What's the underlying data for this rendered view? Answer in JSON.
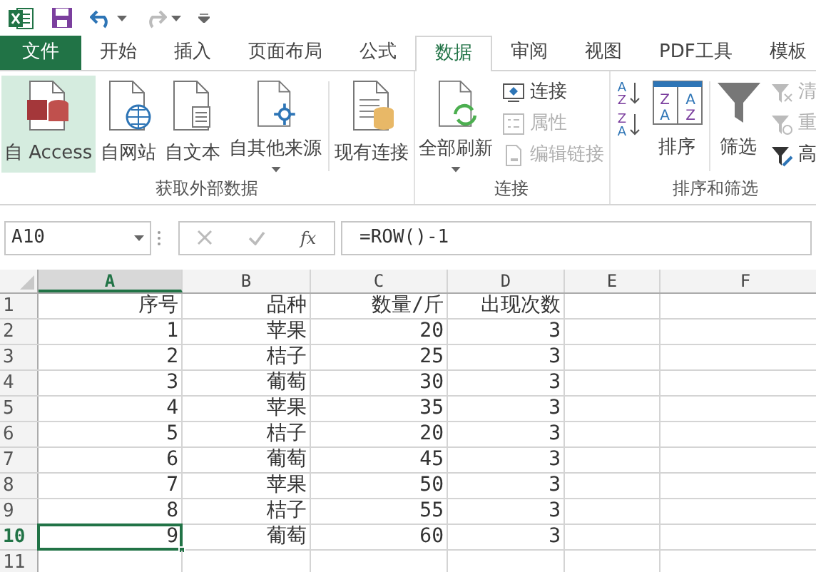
{
  "tabs": [
    {
      "label": "文件",
      "kind": "file",
      "selected": false
    },
    {
      "label": "开始",
      "kind": "tab",
      "selected": false
    },
    {
      "label": "插入",
      "kind": "tab",
      "selected": false
    },
    {
      "label": "页面布局",
      "kind": "tab",
      "selected": false
    },
    {
      "label": "公式",
      "kind": "tab",
      "selected": false
    },
    {
      "label": "数据",
      "kind": "tab",
      "selected": true
    },
    {
      "label": "审阅",
      "kind": "tab",
      "selected": false
    },
    {
      "label": "视图",
      "kind": "tab",
      "selected": false
    },
    {
      "label": "PDF工具",
      "kind": "tab",
      "selected": false
    },
    {
      "label": "模板",
      "kind": "tab",
      "selected": false
    }
  ],
  "ribbon": {
    "groups": [
      {
        "label": "获取外部数据",
        "items": [
          {
            "kind": "large",
            "label": "自 Access",
            "selected": true
          },
          {
            "kind": "large",
            "label": "自网站",
            "selected": false
          },
          {
            "kind": "large",
            "label": "自文本",
            "selected": false
          },
          {
            "kind": "large",
            "label": "自其他来源",
            "selected": false,
            "dropdown": true
          },
          {
            "kind": "separator"
          },
          {
            "kind": "large",
            "label": "现有连接",
            "selected": false
          }
        ]
      },
      {
        "label": "连接",
        "items": [
          {
            "kind": "large",
            "label": "全部刷新",
            "selected": false,
            "dropdown": true
          },
          {
            "kind": "stack",
            "buttons": [
              {
                "label": "连接",
                "disabled": false
              },
              {
                "label": "属性",
                "disabled": true
              },
              {
                "label": "编辑链接",
                "disabled": true
              }
            ]
          }
        ]
      },
      {
        "label": "排序和筛选",
        "items": [
          {
            "kind": "stack",
            "buttons": [
              {
                "letters": [
                  "A",
                  "Z"
                ]
              },
              {
                "letters": [
                  "Z",
                  "A"
                ]
              }
            ]
          },
          {
            "kind": "large",
            "label": "排序",
            "selected": false,
            "letters": [
              "Z",
              "A",
              "A",
              "Z"
            ]
          },
          {
            "kind": "separator"
          },
          {
            "kind": "large",
            "label": "筛选",
            "selected": false
          },
          {
            "kind": "stack",
            "buttons": [
              {
                "label": "清",
                "disabled": true
              },
              {
                "label": "重",
                "disabled": true
              },
              {
                "label": "高",
                "disabled": false
              }
            ]
          }
        ]
      }
    ]
  },
  "formula_bar": {
    "name_box": "A10",
    "fx": "fx",
    "formula": "=ROW()-1"
  },
  "sheet": {
    "columns": [
      {
        "label": "A",
        "selected": true
      },
      {
        "label": "B",
        "selected": false
      },
      {
        "label": "C",
        "selected": false
      },
      {
        "label": "D",
        "selected": false
      },
      {
        "label": "E",
        "selected": false
      },
      {
        "label": "F",
        "selected": false
      }
    ],
    "rows": [
      {
        "label": "1",
        "selected": false,
        "cells": [
          {
            "text": "序号",
            "selected": false
          },
          {
            "text": "品种",
            "selected": false
          },
          {
            "text": "数量/斤",
            "selected": false
          },
          {
            "text": "出现次数",
            "selected": false
          }
        ]
      },
      {
        "label": "2",
        "selected": false,
        "cells": [
          {
            "text": "1",
            "selected": false
          },
          {
            "text": "苹果",
            "selected": false
          },
          {
            "text": "20",
            "selected": false
          },
          {
            "text": "3",
            "selected": false
          }
        ]
      },
      {
        "label": "3",
        "selected": false,
        "cells": [
          {
            "text": "2",
            "selected": false
          },
          {
            "text": "桔子",
            "selected": false
          },
          {
            "text": "25",
            "selected": false
          },
          {
            "text": "3",
            "selected": false
          }
        ]
      },
      {
        "label": "4",
        "selected": false,
        "cells": [
          {
            "text": "3",
            "selected": false
          },
          {
            "text": "葡萄",
            "selected": false
          },
          {
            "text": "30",
            "selected": false
          },
          {
            "text": "3",
            "selected": false
          }
        ]
      },
      {
        "label": "5",
        "selected": false,
        "cells": [
          {
            "text": "4",
            "selected": false
          },
          {
            "text": "苹果",
            "selected": false
          },
          {
            "text": "35",
            "selected": false
          },
          {
            "text": "3",
            "selected": false
          }
        ]
      },
      {
        "label": "6",
        "selected": false,
        "cells": [
          {
            "text": "5",
            "selected": false
          },
          {
            "text": "桔子",
            "selected": false
          },
          {
            "text": "20",
            "selected": false
          },
          {
            "text": "3",
            "selected": false
          }
        ]
      },
      {
        "label": "7",
        "selected": false,
        "cells": [
          {
            "text": "6",
            "selected": false
          },
          {
            "text": "葡萄",
            "selected": false
          },
          {
            "text": "45",
            "selected": false
          },
          {
            "text": "3",
            "selected": false
          }
        ]
      },
      {
        "label": "8",
        "selected": false,
        "cells": [
          {
            "text": "7",
            "selected": false
          },
          {
            "text": "苹果",
            "selected": false
          },
          {
            "text": "50",
            "selected": false
          },
          {
            "text": "3",
            "selected": false
          }
        ]
      },
      {
        "label": "9",
        "selected": false,
        "cells": [
          {
            "text": "8",
            "selected": false
          },
          {
            "text": "桔子",
            "selected": false
          },
          {
            "text": "55",
            "selected": false
          },
          {
            "text": "3",
            "selected": false
          }
        ]
      },
      {
        "label": "10",
        "selected": true,
        "cells": [
          {
            "text": "9",
            "selected": true
          },
          {
            "text": "葡萄",
            "selected": false
          },
          {
            "text": "60",
            "selected": false
          },
          {
            "text": "3",
            "selected": false
          }
        ]
      },
      {
        "label": "11",
        "selected": false
      }
    ]
  }
}
